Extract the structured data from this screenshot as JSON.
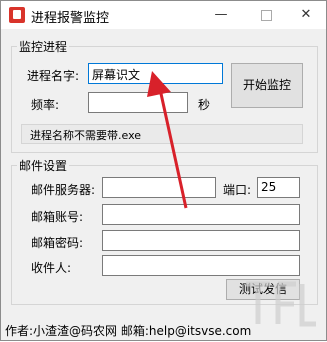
{
  "window": {
    "title": "进程报警监控"
  },
  "group_monitor": {
    "title": "监控进程",
    "process_label": "进程名字:",
    "process_value": "屏幕识文",
    "freq_label": "频率:",
    "freq_value": "",
    "freq_unit": "秒",
    "start_button": "开始监控",
    "hint": "进程名称不需要带.exe"
  },
  "group_mail": {
    "title": "邮件设置",
    "server_label": "邮件服务器:",
    "server_value": "",
    "port_label": "端口:",
    "port_value": "25",
    "account_label": "邮箱账号:",
    "account_value": "",
    "password_label": "邮箱密码:",
    "password_value": "",
    "recipient_label": "收件人:",
    "recipient_value": "",
    "test_button": "测试发信"
  },
  "footer": {
    "text": "作者:小渣渣@码农网   邮箱:help@itsvse.com"
  },
  "colors": {
    "arrow": "#d8212a",
    "focus_border": "#0078d7"
  }
}
